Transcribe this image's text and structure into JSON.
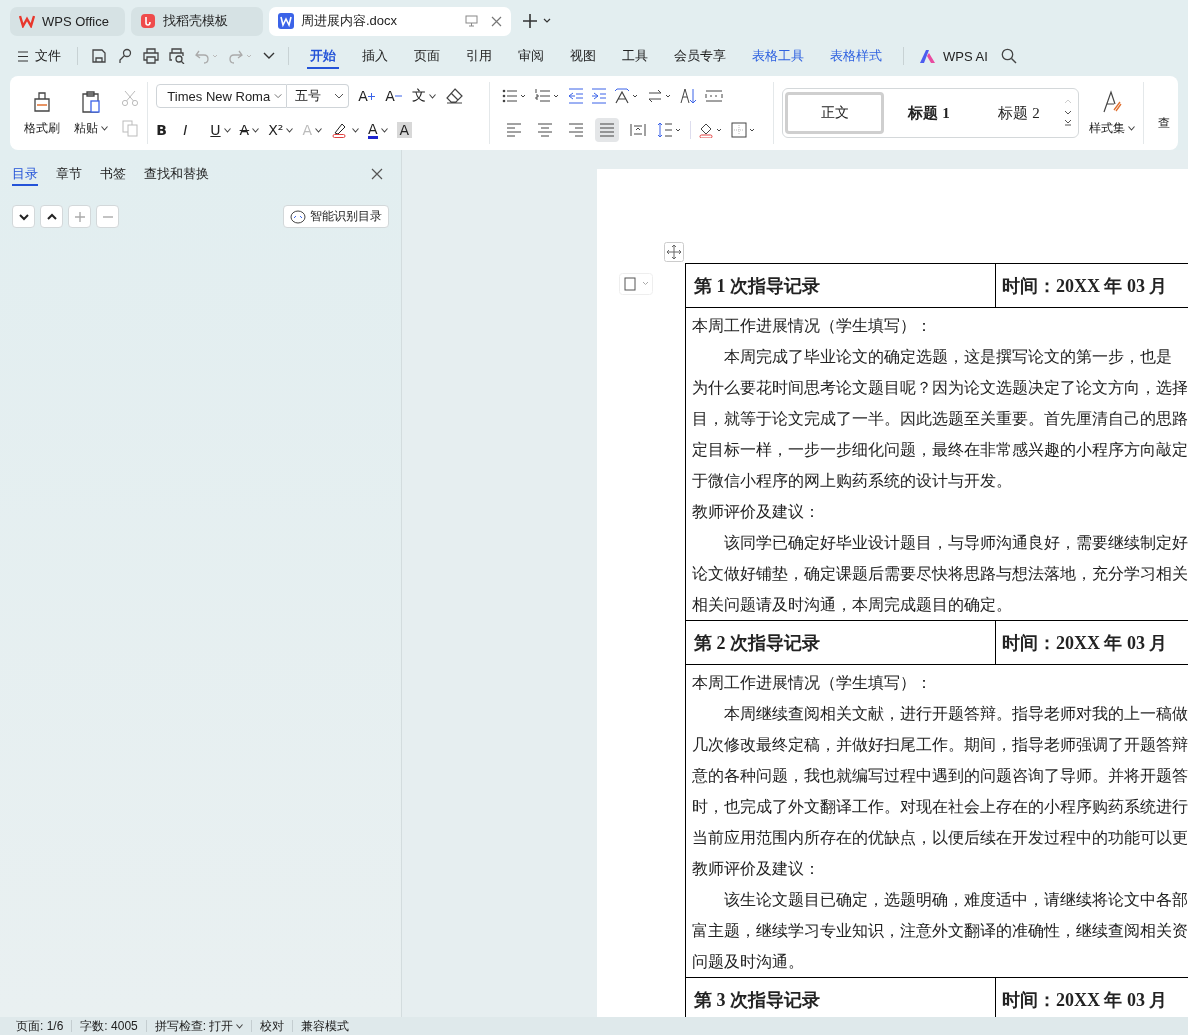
{
  "tabs": [
    {
      "label": "WPS Office",
      "kind": "home",
      "selected": false
    },
    {
      "label": "找稻壳模板",
      "kind": "template",
      "selected": false
    },
    {
      "label": "周进展内容.docx",
      "kind": "doc",
      "selected": true
    }
  ],
  "menu": {
    "file": "文件",
    "items": [
      {
        "label": "开始",
        "kind": "main",
        "selected": true
      },
      {
        "label": "插入",
        "kind": "main",
        "selected": false
      },
      {
        "label": "页面",
        "kind": "main",
        "selected": false
      },
      {
        "label": "引用",
        "kind": "main",
        "selected": false
      },
      {
        "label": "审阅",
        "kind": "main",
        "selected": false
      },
      {
        "label": "视图",
        "kind": "main",
        "selected": false
      },
      {
        "label": "工具",
        "kind": "main",
        "selected": false
      },
      {
        "label": "会员专享",
        "kind": "main",
        "selected": false
      },
      {
        "label": "表格工具",
        "kind": "context",
        "selected": false
      },
      {
        "label": "表格样式",
        "kind": "context",
        "selected": false
      }
    ],
    "ai": "WPS AI"
  },
  "ribbon": {
    "format_painter": "格式刷",
    "paste": "粘贴",
    "font": "Times New Roma",
    "size": "五号",
    "font_buttons": [
      {
        "glyph": "A",
        "kind": "grow"
      },
      {
        "glyph": "A",
        "kind": "shrink"
      },
      {
        "glyph": "文",
        "kind": "phonetic"
      }
    ],
    "format_buttons": [
      {
        "glyph": "B",
        "kind": "bold",
        "disabled": false
      },
      {
        "glyph": "I",
        "kind": "italic",
        "disabled": false
      },
      {
        "glyph": "U",
        "kind": "underline",
        "disabled": false
      },
      {
        "glyph": "A",
        "kind": "strike",
        "disabled": false
      },
      {
        "glyph": "X²",
        "kind": "superscript",
        "disabled": false
      },
      {
        "glyph": "A",
        "kind": "effect",
        "disabled": true
      },
      {
        "kind": "highlight",
        "disabled": false
      },
      {
        "glyph": "A",
        "kind": "color",
        "disabled": false
      },
      {
        "glyph": "A",
        "kind": "shade",
        "disabled": false
      }
    ],
    "align_buttons": [
      {
        "kind": "left",
        "selected": false
      },
      {
        "kind": "center",
        "selected": false
      },
      {
        "kind": "right",
        "selected": false
      },
      {
        "kind": "justify",
        "selected": true
      },
      {
        "kind": "distribute",
        "selected": false
      }
    ],
    "styles": [
      {
        "label": "正文",
        "kind": "body",
        "selected": true
      },
      {
        "label": "标题 1",
        "kind": "h1",
        "selected": false
      },
      {
        "label": "标题 2",
        "kind": "h2",
        "selected": false
      }
    ],
    "style_set": "样式集",
    "cut_group": "查"
  },
  "sidebar": {
    "tabs": [
      {
        "label": "目录",
        "selected": true
      },
      {
        "label": "章节",
        "selected": false
      },
      {
        "label": "书签",
        "selected": false
      },
      {
        "label": "查找和替换",
        "selected": false
      }
    ],
    "tools": [
      {
        "kind": "down",
        "disabled": false
      },
      {
        "kind": "up",
        "disabled": false
      },
      {
        "kind": "plus",
        "disabled": true
      },
      {
        "kind": "minus",
        "disabled": true
      }
    ],
    "smart_toc": "智能识别目录"
  },
  "document": {
    "records": [
      {
        "title": "第 1 次指导记录",
        "time": "时间：20XX 年 03 月",
        "paragraphs": [
          {
            "indent": false,
            "lines": [
              "本周工作进展情况（学生填写）："
            ]
          },
          {
            "indent": true,
            "lines": [
              "本周完成了毕业论文的确定选题，这是撰写论文的第一步，也是",
              "为什么要花时间思考论文题目呢？因为论文选题决定了论文方向，选择",
              "目，就等于论文完成了一半。因此选题至关重要。首先厘清自己的思路",
              "定目标一样，一步一步细化问题，最终在非常感兴趣的小程序方向敲定",
              "于微信小程序的网上购药系统的设计与开发。"
            ]
          },
          {
            "indent": false,
            "lines": [
              "教师评价及建议："
            ]
          },
          {
            "indent": true,
            "lines": [
              "该同学已确定好毕业设计题目，与导师沟通良好，需要继续制定好",
              "论文做好铺垫，确定课题后需要尽快将思路与想法落地，充分学习相关",
              "相关问题请及时沟通，本周完成题目的确定。"
            ]
          }
        ]
      },
      {
        "title": "第 2 次指导记录",
        "time": "时间：20XX 年 03 月",
        "paragraphs": [
          {
            "indent": false,
            "lines": [
              "本周工作进展情况（学生填写）："
            ]
          },
          {
            "indent": true,
            "lines": [
              "本周继续查阅相关文献，进行开题答辩。指导老师对我的上一稿做",
              "几次修改最终定稿，并做好扫尾工作。期间，指导老师强调了开题答辩",
              "意的各种问题，我也就编写过程中遇到的问题咨询了导师。并将开题答",
              "时，也完成了外文翻译工作。对现在社会上存在的小程序购药系统进行",
              "当前应用范围内所存在的优缺点，以便后续在开发过程中的功能可以更"
            ]
          },
          {
            "indent": false,
            "lines": [
              "教师评价及建议："
            ]
          },
          {
            "indent": true,
            "lines": [
              "该生论文题目已确定，选题明确，难度适中，请继续将论文中各部",
              "富主题，继续学习专业知识，注意外文翻译的准确性，继续查阅相关资",
              "问题及时沟通。"
            ]
          }
        ]
      },
      {
        "title": "第 3 次指导记录",
        "time": "时间：20XX 年 03 月"
      }
    ]
  },
  "status_bar": [
    {
      "label": "页面: 1/6",
      "dropdown": false
    },
    {
      "label": "字数: 4005",
      "dropdown": false
    },
    {
      "label": "拼写检查: 打开",
      "dropdown": true
    },
    {
      "label": "校对",
      "dropdown": false
    },
    {
      "label": "兼容模式",
      "dropdown": false
    }
  ]
}
